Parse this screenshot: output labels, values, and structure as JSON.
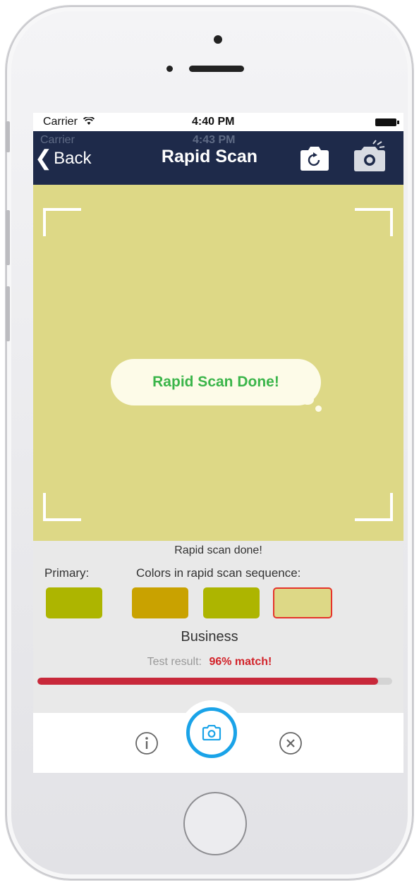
{
  "status_bar": {
    "carrier": "Carrier",
    "time": "4:40 PM"
  },
  "status_bar_ghost": {
    "carrier": "Carrier",
    "time": "4:43 PM"
  },
  "nav": {
    "back_label": "Back",
    "title": "Rapid Scan",
    "flip_camera_icon": "camera-flip-icon",
    "camera_icon": "camera-flash-icon"
  },
  "viewfinder": {
    "toast": "Rapid Scan Done!"
  },
  "results": {
    "message": "Rapid scan done!",
    "primary_label": "Primary:",
    "sequence_label": "Colors in rapid scan sequence:",
    "primary_color": "#adb500",
    "sequence_colors": [
      "#c9a200",
      "#adb500",
      "#ddd886"
    ],
    "selected_highlight": "#e5332a",
    "category": "Business",
    "test_result_label": "Test result:",
    "match_text": "96% match!",
    "match_progress": 0.96,
    "progress_color": "#c8283a"
  },
  "tabbar": {
    "info_icon": "info-icon",
    "shutter_icon": "camera-icon",
    "close_icon": "close-circle-icon",
    "accent": "#1aa3e8"
  }
}
